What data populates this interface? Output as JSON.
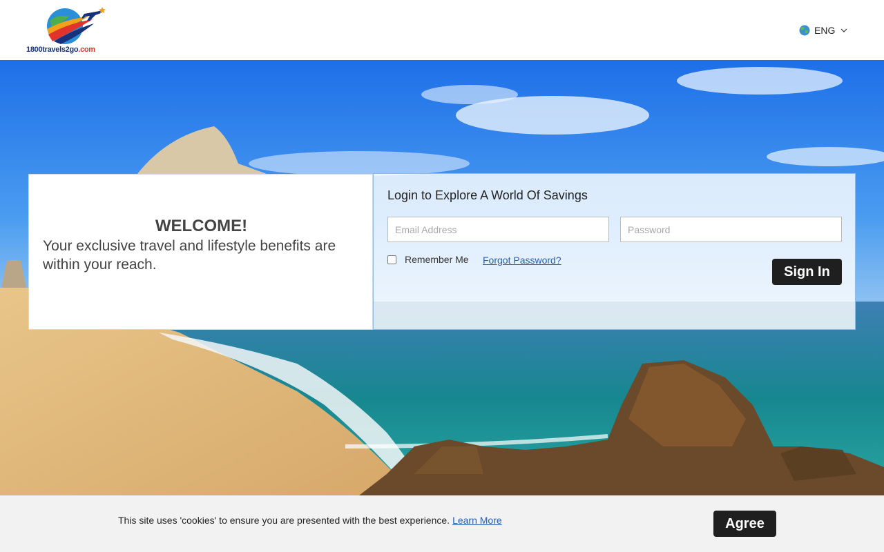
{
  "header": {
    "logo_text": "1800travels2go",
    "logo_suffix": ".com",
    "language": {
      "label": "ENG",
      "icon": "globe-icon"
    }
  },
  "welcome": {
    "title": "WELCOME!",
    "text": "Your exclusive travel and lifestyle benefits are within your reach."
  },
  "login": {
    "title": "Login to Explore A World Of Savings",
    "email_placeholder": "Email Address",
    "email_value": "",
    "password_placeholder": "Password",
    "password_value": "",
    "remember_label": "Remember Me",
    "remember_checked": false,
    "forgot_label": "Forgot Password?",
    "signin_label": "Sign In"
  },
  "cookie_bar": {
    "text": "This site uses 'cookies' to ensure you are presented with the best experience.",
    "link_label": "Learn More",
    "agree_label": "Agree"
  },
  "colors": {
    "button_bg": "#1f1f1f",
    "link": "#2a5db0",
    "panel_border": "#8fb9e6"
  }
}
